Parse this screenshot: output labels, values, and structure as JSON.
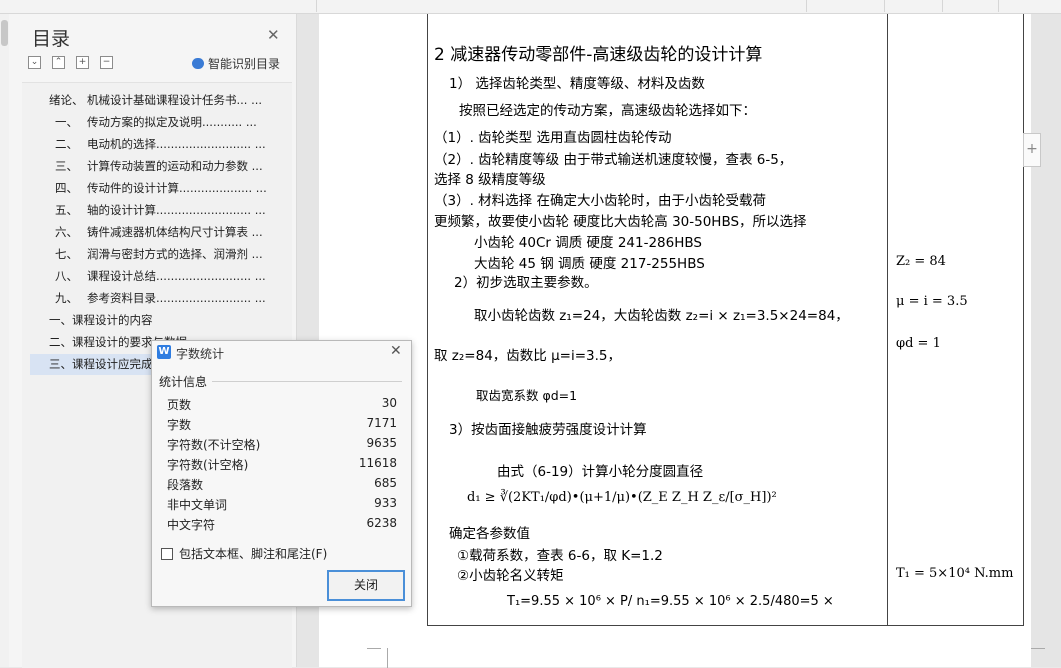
{
  "outline": {
    "title": "目录",
    "smart_label": "智能识别目录",
    "tool_labels": [
      "⌄",
      "⌃",
      "+",
      "−"
    ],
    "items": [
      {
        "num": "绪论、",
        "label": "机械设计基础课程设计任务书... ..."
      },
      {
        "num": "一、",
        "label": "传动方案的拟定及说明........... ..."
      },
      {
        "num": "二、",
        "label": "电动机的选择.......................... ..."
      },
      {
        "num": "三、",
        "label": "计算传动装置的运动和动力参数 ..."
      },
      {
        "num": "四、",
        "label": "传动件的设计计算.................... ..."
      },
      {
        "num": "五、",
        "label": "轴的设计计算.......................... ..."
      },
      {
        "num": "六、",
        "label": "铸件减速器机体结构尺寸计算表 ..."
      },
      {
        "num": "七、",
        "label": "润滑与密封方式的选择、润滑剂 ..."
      },
      {
        "num": "八、",
        "label": "课程设计总结.......................... ..."
      },
      {
        "num": "九、",
        "label": "参考资料目录.......................... ..."
      },
      {
        "num": "",
        "label": "一、课程设计的内容"
      },
      {
        "num": "",
        "label": "二、课程设计的要求与数据"
      },
      {
        "num": "",
        "label": "三、课程设计应完成"
      }
    ]
  },
  "document": {
    "heading": "2 减速器传动零部件-高速级齿轮的设计计算",
    "lines": [
      "1） 选择齿轮类型、精度等级、材料及齿数",
      "按照已经选定的传动方案，高速级齿轮选择如下：",
      "（1）. 齿轮类型       选用直齿圆柱齿轮传动",
      "（2）. 齿轮精度等级    由于带式输送机速度较慢，查表 6-5，",
      "选择 8 级精度等级",
      "（3）. 材料选择       在确定大小齿轮时，由于小齿轮受载荷",
      "更频繁，故要使小齿轮  硬度比大齿轮高 30-50HBS，所以选择",
      "小齿轮    40Cr    调质  硬度   241-286HBS",
      "大齿轮    45 钢    调质  硬度   217-255HBS",
      "2）初步选取主要参数。",
      "取小齿轮齿数 z₁=24，大齿轮齿数 z₂=i × z₁=3.5×24=84，",
      "取 z₂=84，齿数比 μ=i=3.5，",
      "取齿宽系数 φd=1",
      "3）按齿面接触疲劳强度设计计算",
      "由式（6-19）计算小轮分度圆直径",
      "d₁ ≥ ∛(2KT₁/φd)•(μ+1/μ)•(Z_E Z_H Z_ε/[σ_H])²",
      "确定各参数值",
      "①载荷系数，查表 6-6，取 K=1.2",
      "②小齿轮名义转矩",
      "T₁=9.55 × 10⁶ × P/ n₁=9.55 × 10⁶ × 2.5/480=5 ×"
    ],
    "right_col": [
      "Z₂ = 84",
      "μ = i = 3.5",
      "φd = 1",
      "T₁ = 5×10⁴ N.mm"
    ],
    "side_button": "+"
  },
  "dialog": {
    "title": "字数统计",
    "section": "统计信息",
    "stats": [
      {
        "k": "页数",
        "v": "30"
      },
      {
        "k": "字数",
        "v": "7171"
      },
      {
        "k": "字符数(不计空格)",
        "v": "9635"
      },
      {
        "k": "字符数(计空格)",
        "v": "11618"
      },
      {
        "k": "段落数",
        "v": "685"
      },
      {
        "k": "非中文单词",
        "v": "933"
      },
      {
        "k": "中文字符",
        "v": "6238"
      }
    ],
    "checkbox": "包括文本框、脚注和尾注(F)",
    "close_button": "关闭"
  }
}
